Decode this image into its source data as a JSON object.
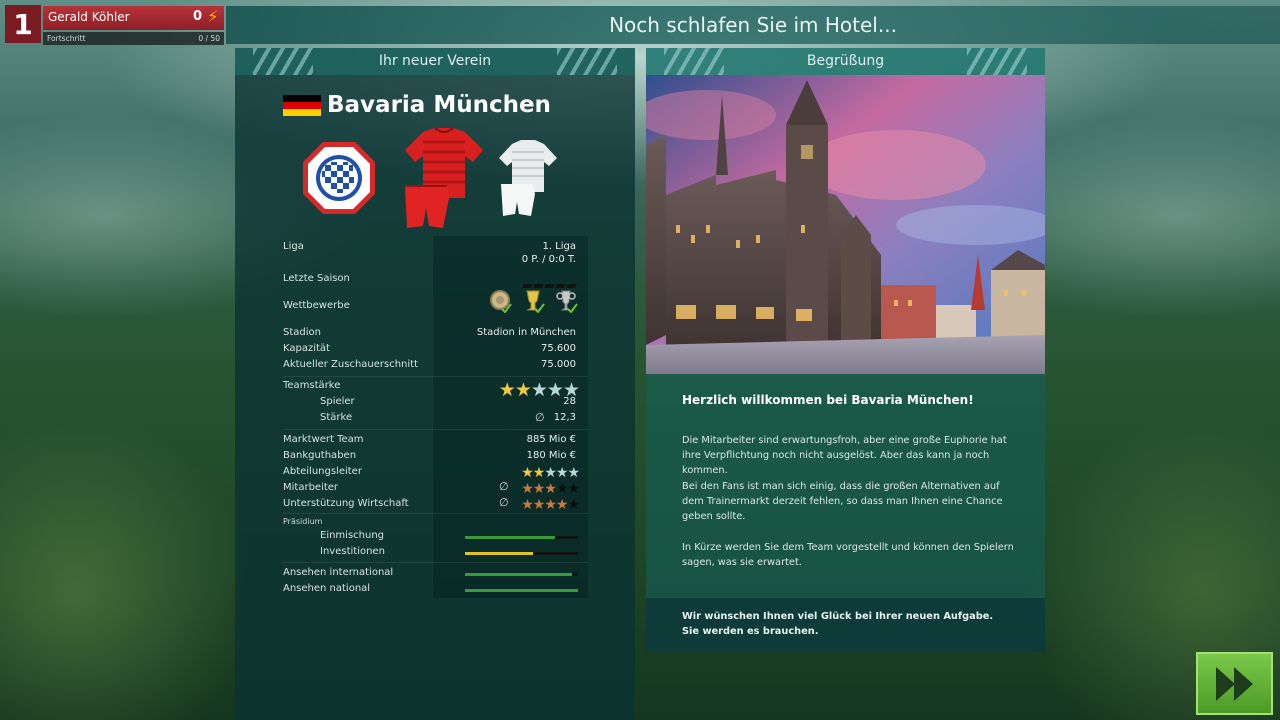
{
  "profile": {
    "level": "1",
    "name": "Gerald Köhler",
    "points": "0",
    "progress_label": "Fortschritt",
    "progress_value": "0 / 50"
  },
  "banner": {
    "title": "Noch schlafen Sie im Hotel..."
  },
  "left_panel": {
    "header": "Ihr neuer Verein",
    "club_name": "Bavaria München",
    "flag_colors": [
      "#000000",
      "#dd0000",
      "#ffce00"
    ],
    "rows": {
      "liga": {
        "label": "Liga",
        "value": "1. Liga",
        "value2": "0 P. / 0:0 T."
      },
      "letzte_saison": {
        "label": "Letzte Saison"
      },
      "wettbewerbe": {
        "label": "Wettbewerbe"
      },
      "stadion": {
        "label": "Stadion",
        "value": "Stadion in München"
      },
      "kapazitaet": {
        "label": "Kapazität",
        "value": "75.600"
      },
      "zuschauer": {
        "label": "Aktueller Zuschauerschnitt",
        "value": "75.000"
      },
      "teamstaerke": {
        "label": "Teamstärke",
        "stars": 2,
        "max": 5
      },
      "spieler": {
        "label": "Spieler",
        "value": "28"
      },
      "staerke": {
        "label": "Stärke",
        "avg_symbol": "∅",
        "value": "12,3"
      },
      "marktwert": {
        "label": "Marktwert Team",
        "value": "885 Mio €"
      },
      "bank": {
        "label": "Bankguthaben",
        "value": "180 Mio €"
      },
      "abteilungsleiter": {
        "label": "Abteilungsleiter",
        "stars": 2,
        "max": 5
      },
      "mitarbeiter": {
        "label": "Mitarbeiter",
        "avg_symbol": "∅",
        "stars": 3,
        "max": 5
      },
      "wirtschaft": {
        "label": "Unterstützung Wirtschaft",
        "avg_symbol": "∅",
        "stars": 4,
        "max": 5
      },
      "praesidium": {
        "label": "Präsidium"
      },
      "einmischung": {
        "label": "Einmischung",
        "level": 0.8,
        "color": "#3a9a3a"
      },
      "investitionen": {
        "label": "Investitionen",
        "level": 0.6,
        "color": "#e2c421"
      },
      "ansehen_int": {
        "label": "Ansehen international",
        "level": 0.95,
        "color": "#3a9a3a"
      },
      "ansehen_nat": {
        "label": "Ansehen national",
        "level": 1.0,
        "color": "#3a9a3a"
      }
    }
  },
  "right_panel": {
    "header": "Begrüßung",
    "welcome_title": "Herzlich willkommen bei Bavaria München!",
    "paragraphs": [
      "Die Mitarbeiter sind erwartungsfroh, aber eine große Euphorie hat ihre Verpflichtung noch nicht ausgelöst. Aber das kann ja noch kommen.",
      "Bei den Fans ist man sich einig, dass die großen Alternativen auf dem Trainermarkt derzeit fehlen, so dass man Ihnen eine Chance geben sollte.",
      "In Kürze werden Sie dem Team vorgestellt und können den Spielern sagen, was sie erwartet."
    ],
    "footer": "Wir wünschen Ihnen viel Glück bei Ihrer neuen Aufgabe. Sie werden es brauchen."
  },
  "colors": {
    "star_gold": "#f2c744",
    "star_empty": "#b8d6d8",
    "star_bronze": "#d2773b",
    "star_dark": "#0c0c0c",
    "accent_green": "#6cbd3d"
  },
  "icons": [
    "lightning-icon",
    "double-chevron-right-icon",
    "trophy-icon",
    "checkmark-icon"
  ]
}
